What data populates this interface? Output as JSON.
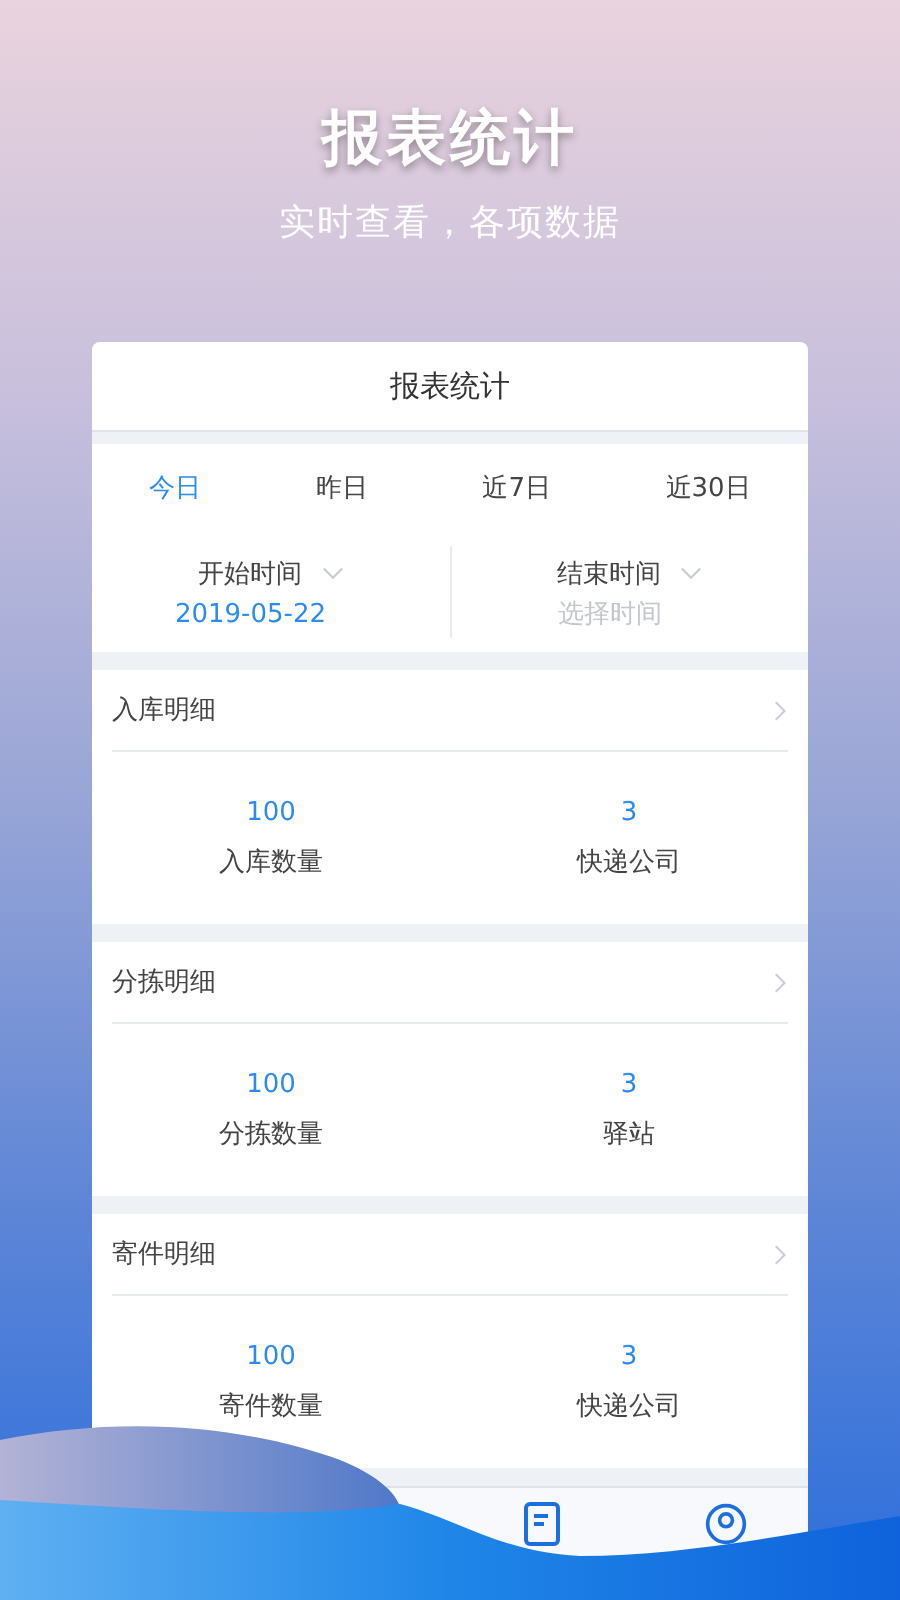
{
  "hero": {
    "title": "报表统计",
    "subtitle": "实时查看，各项数据"
  },
  "card": {
    "title": "报表统计"
  },
  "tabs": [
    {
      "label": "今日",
      "selected": true
    },
    {
      "label": "昨日",
      "selected": false
    },
    {
      "label": "近7日",
      "selected": false
    },
    {
      "label": "近30日",
      "selected": false
    }
  ],
  "date_range": [
    {
      "label": "开始时间",
      "value": "2019-05-22"
    },
    {
      "label": "结束时间",
      "placeholder": "选择时间"
    }
  ],
  "sections": [
    {
      "title": "入库明细",
      "stats": [
        {
          "value": "100",
          "label": "入库数量"
        },
        {
          "value": "3",
          "label": "快递公司"
        }
      ]
    },
    {
      "title": "分拣明细",
      "stats": [
        {
          "value": "100",
          "label": "分拣数量"
        },
        {
          "value": "3",
          "label": "驿站"
        }
      ]
    },
    {
      "title": "寄件明细",
      "stats": [
        {
          "value": "100",
          "label": "寄件数量"
        },
        {
          "value": "3",
          "label": "快递公司"
        }
      ]
    }
  ]
}
